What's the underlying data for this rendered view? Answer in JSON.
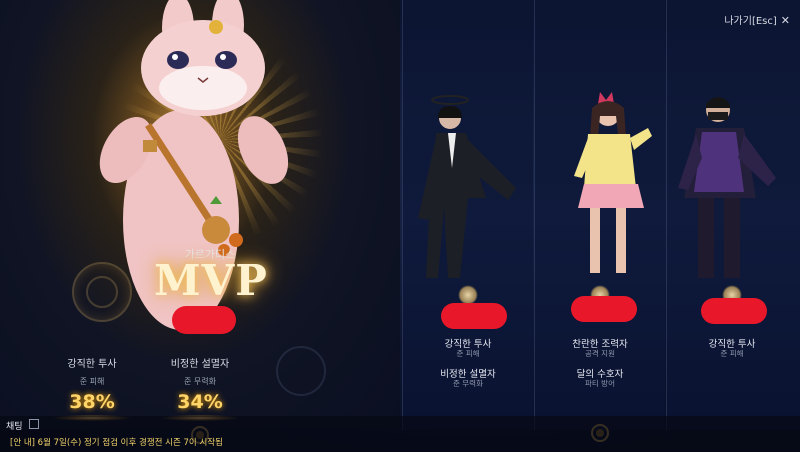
{
  "window": {
    "exit_label": "나가기[Esc]",
    "exit_icon": "close-icon"
  },
  "mvp": {
    "guild_label": "가르가디스",
    "title": "MVP",
    "stats": [
      {
        "title": "강직한 투사",
        "subtitle": "준 피해",
        "percent": "38%"
      },
      {
        "title": "비정한 설멸자",
        "subtitle": "준 무력화",
        "percent": "34%"
      }
    ]
  },
  "players": [
    {
      "class_icon": "berserker-class-icon",
      "award1_title": "강직한 투사",
      "award1_sub": "준 피해",
      "award2_title": "비정한 설멸자",
      "award2_sub": "준 무력화"
    },
    {
      "class_icon": "bard-class-icon",
      "award1_title": "찬란한 조력자",
      "award1_sub": "공격 지원",
      "award2_title": "달의 수호자",
      "award2_sub": "파티 방어"
    },
    {
      "class_icon": "blade-class-icon",
      "award1_title": "강직한 투사",
      "award1_sub": "준 피해",
      "award2_title": "",
      "award2_sub": ""
    }
  ],
  "chat": {
    "tab_label": "채팅",
    "message": "[안 내] 6월 7일(수) 정기 점검 이후 경쟁전 시즌 7이 시작됩"
  },
  "colors": {
    "accent_gold": "#ffd56a",
    "redaction": "#e8182a",
    "background": "#070b1a"
  }
}
